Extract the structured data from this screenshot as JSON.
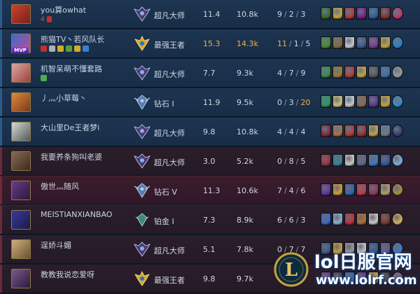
{
  "colors": {
    "blue_team": "#1e3552",
    "red_team": "#2b1e2b",
    "highlight": "#f0b14a",
    "badge_red": "#ff4040"
  },
  "players": [
    {
      "name": "you算owhat",
      "badge_text": "4",
      "avatar": [
        "#c8442f",
        "#7a1f1a"
      ],
      "badges": [],
      "rank": "超凡大师",
      "rank_icon": "master",
      "score": "11.4",
      "gold": "10.8k",
      "kda": [
        "9",
        "2",
        "3"
      ],
      "highlight": [],
      "items": [
        "#3c6b2a",
        "#c8a23b",
        "#b23a3a",
        "#7a1f88",
        "#2f5e9c",
        "#883030",
        "#c0376a"
      ],
      "row_class": "blue"
    },
    {
      "name": "熊猫TV丶若风队长",
      "badge_text": "",
      "mvp_label": "MVP",
      "avatar": [
        "#3b6bc9",
        "#c84a9a"
      ],
      "badges": [
        "#c03030",
        "#b0b0b0",
        "#d6a92b",
        "#5aa03a",
        "#d6a92b",
        "#3b7fd1"
      ],
      "rank": "最强王者",
      "rank_icon": "challenger",
      "score": "15.3",
      "gold": "14.3k",
      "kda": [
        "11",
        "1",
        "5"
      ],
      "highlight": [
        "score",
        "gold",
        "k"
      ],
      "items": [
        "#4b8a2b",
        "#8a6a3b",
        "#c9c9c9",
        "#3d5a8c",
        "#7a3a8e",
        "#c8a23b",
        "#2b7ec9"
      ],
      "row_class": "blue"
    },
    {
      "name": "机智呆萌不懂套路",
      "badge_text": "",
      "avatar": [
        "#d8a8a0",
        "#a04040"
      ],
      "badges": [
        "#4caf50"
      ],
      "rank": "超凡大师",
      "rank_icon": "master",
      "score": "7.7",
      "gold": "9.3k",
      "kda": [
        "4",
        "7",
        "9"
      ],
      "highlight": [],
      "items": [
        "#3c8a4a",
        "#a07a2b",
        "#b23a3a",
        "#c8a23b",
        "#5a5a5a",
        "#3a6eb0",
        "#9a9a9a"
      ],
      "row_class": "blue"
    },
    {
      "name": "丿灬小草莓丶",
      "badge_text": "",
      "avatar": [
        "#e08a3a",
        "#7a3a1a"
      ],
      "badges": [],
      "rank": "钻石 I",
      "rank_icon": "diamond",
      "score": "11.9",
      "gold": "9.5k",
      "kda": [
        "0",
        "3",
        "20"
      ],
      "highlight": [
        "a"
      ],
      "items": [
        "#2a9a5a",
        "#d0c070",
        "#c9c9c9",
        "#8a6a4a",
        "#5a3a8a",
        "#c8a23b",
        "#3a8ac9"
      ],
      "row_class": "blue"
    },
    {
      "name": "大山里De王者梦i",
      "badge_text": "",
      "avatar": [
        "#d8d8d0",
        "#505a60"
      ],
      "badges": [],
      "rank": "超凡大师",
      "rank_icon": "master",
      "score": "9.8",
      "gold": "10.8k",
      "kda": [
        "4",
        "4",
        "4"
      ],
      "highlight": [],
      "items": [
        "#8a2a3a",
        "#b07040",
        "#b23a3a",
        "#a03030",
        "#c9a040",
        "#6a7a8a",
        "#3a3a6a"
      ],
      "row_class": "blue"
    },
    {
      "name": "我要养条狗叫老婆",
      "badge_text": "",
      "avatar": [
        "#8a6a50",
        "#3a2a20"
      ],
      "badges": [],
      "rank": "超凡大师",
      "rank_icon": "master",
      "score": "3.0",
      "gold": "5.2k",
      "kda": [
        "0",
        "8",
        "5"
      ],
      "highlight": [],
      "items": [
        "#a03040",
        "#2a8a9a",
        "#c9c9c9",
        "#5a6a8a",
        "#3a7ac9",
        "#2a5aa0",
        "#7ab0e0"
      ],
      "row_class": "red"
    },
    {
      "name": "傲世灬随风",
      "badge_text": "",
      "avatar": [
        "#6a3a8a",
        "#2a1a3a"
      ],
      "badges": [],
      "rank": "钻石 V",
      "rank_icon": "diamond",
      "score": "11.3",
      "gold": "10.6k",
      "kda": [
        "7",
        "4",
        "6"
      ],
      "highlight": [],
      "items": [
        "#5a3aa0",
        "#c8a23b",
        "#2a6ab0",
        "#c03a4a",
        "#8a3a5a",
        "#b0a070",
        "#a09040"
      ],
      "row_class": "sel"
    },
    {
      "name": "MEISTIANXIANBAO",
      "badge_text": "",
      "avatar": [
        "#3a3a9a",
        "#1a1a4a"
      ],
      "badges": [],
      "rank": "铂金 I",
      "rank_icon": "platinum",
      "score": "7.3",
      "gold": "8.9k",
      "kda": [
        "6",
        "6",
        "3"
      ],
      "highlight": [],
      "items": [
        "#3a6ac9",
        "#8ab0d0",
        "#c03040",
        "#b07030",
        "#c9c9c9",
        "#7a3a2a",
        "#d0b060"
      ],
      "row_class": "red"
    },
    {
      "name": "逞娇斗媚",
      "badge_text": "",
      "avatar": [
        "#d0b080",
        "#6a5030"
      ],
      "badges": [],
      "rank": "超凡大师",
      "rank_icon": "master",
      "score": "5.1",
      "gold": "7.8k",
      "kda": [
        "0",
        "7",
        "7"
      ],
      "highlight": [],
      "items": [
        "#3a5a8a",
        "#c8a23b",
        "#9a9a9a",
        "#c9c9c9",
        "#2a5aa0",
        "#5a5a9a",
        "#3a7ac9"
      ],
      "row_class": "red"
    },
    {
      "name": "教教我说恋爱呀",
      "badge_text": "",
      "avatar": [
        "#7a5a8a",
        "#2a1a3a"
      ],
      "badges": [],
      "rank": "最强王者",
      "rank_icon": "challenger",
      "score": "9.8",
      "gold": "9.7k",
      "kda": [
        "",
        "",
        ""
      ],
      "highlight": [],
      "items": [
        "#6a3a8a",
        "#3a3a5a",
        "#2a6ab0",
        "#5a3a8a",
        "#c8a23b",
        "#3a3a3a",
        "#8a5a9a"
      ],
      "row_class": "red"
    }
  ],
  "watermark": {
    "title": "lol日服官网",
    "url": "www.lolrf.com",
    "logo_letter": "L"
  }
}
